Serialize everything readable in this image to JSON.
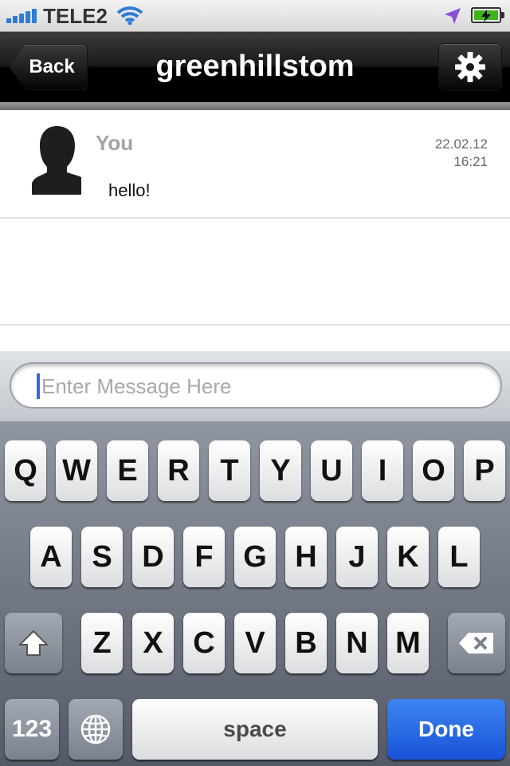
{
  "status_bar": {
    "carrier": "TELE2",
    "signal_bars": 5,
    "battery_state": "charging",
    "icons": [
      "signal-icon",
      "wifi-icon",
      "location-icon",
      "battery-icon"
    ]
  },
  "navbar": {
    "back_label": "Back",
    "title": "greenhillstom",
    "settings_icon": "gear-icon"
  },
  "messages": [
    {
      "sender": "You",
      "date": "22.02.12",
      "time": "16:21",
      "text": "hello!",
      "avatar": "person-silhouette-icon"
    }
  ],
  "composer": {
    "placeholder": "Enter Message Here"
  },
  "keyboard": {
    "row1": [
      "Q",
      "W",
      "E",
      "R",
      "T",
      "Y",
      "U",
      "I",
      "O",
      "P"
    ],
    "row2": [
      "A",
      "S",
      "D",
      "F",
      "G",
      "H",
      "J",
      "K",
      "L"
    ],
    "row3": [
      "Z",
      "X",
      "C",
      "V",
      "B",
      "N",
      "M"
    ],
    "shift_icon": "shift-icon",
    "delete_icon": "backspace-icon",
    "numbers_label": "123",
    "globe_icon": "globe-icon",
    "space_label": "space",
    "done_label": "Done"
  },
  "colors": {
    "accent": "#2f7cd8",
    "done_button": "#1f5fe0",
    "battery": "#3fb41a",
    "navbar": "#000000"
  }
}
